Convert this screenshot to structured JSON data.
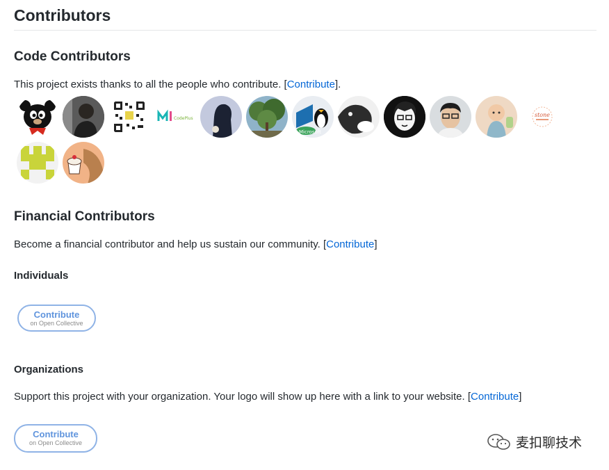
{
  "title": "Contributors",
  "code": {
    "heading": "Code Contributors",
    "text": "This project exists thanks to all the people who contribute. [",
    "link": "Contribute",
    "after": "]."
  },
  "financial": {
    "heading": "Financial Contributors",
    "text": "Become a financial contributor and help us sustain our community. [",
    "link": "Contribute",
    "after": "]"
  },
  "individuals": {
    "heading": "Individuals",
    "button": {
      "line1": "Contribute",
      "line2": "on Open Collective"
    }
  },
  "organizations": {
    "heading": "Organizations",
    "text": "Support this project with your organization. Your logo will show up here with a link to your website. [",
    "link": "Contribute",
    "after": "]",
    "button": {
      "line1": "Contribute",
      "line2": "on Open Collective"
    }
  },
  "avatar_texts": {
    "codeplus": "CodePlus",
    "microsoft": "Microsoft",
    "stone": "stone"
  },
  "watermark": "麦扣聊技术",
  "colors": {
    "link": "#0366d6",
    "oc_border": "#8fb3e6",
    "oc_text": "#5f94dd"
  }
}
